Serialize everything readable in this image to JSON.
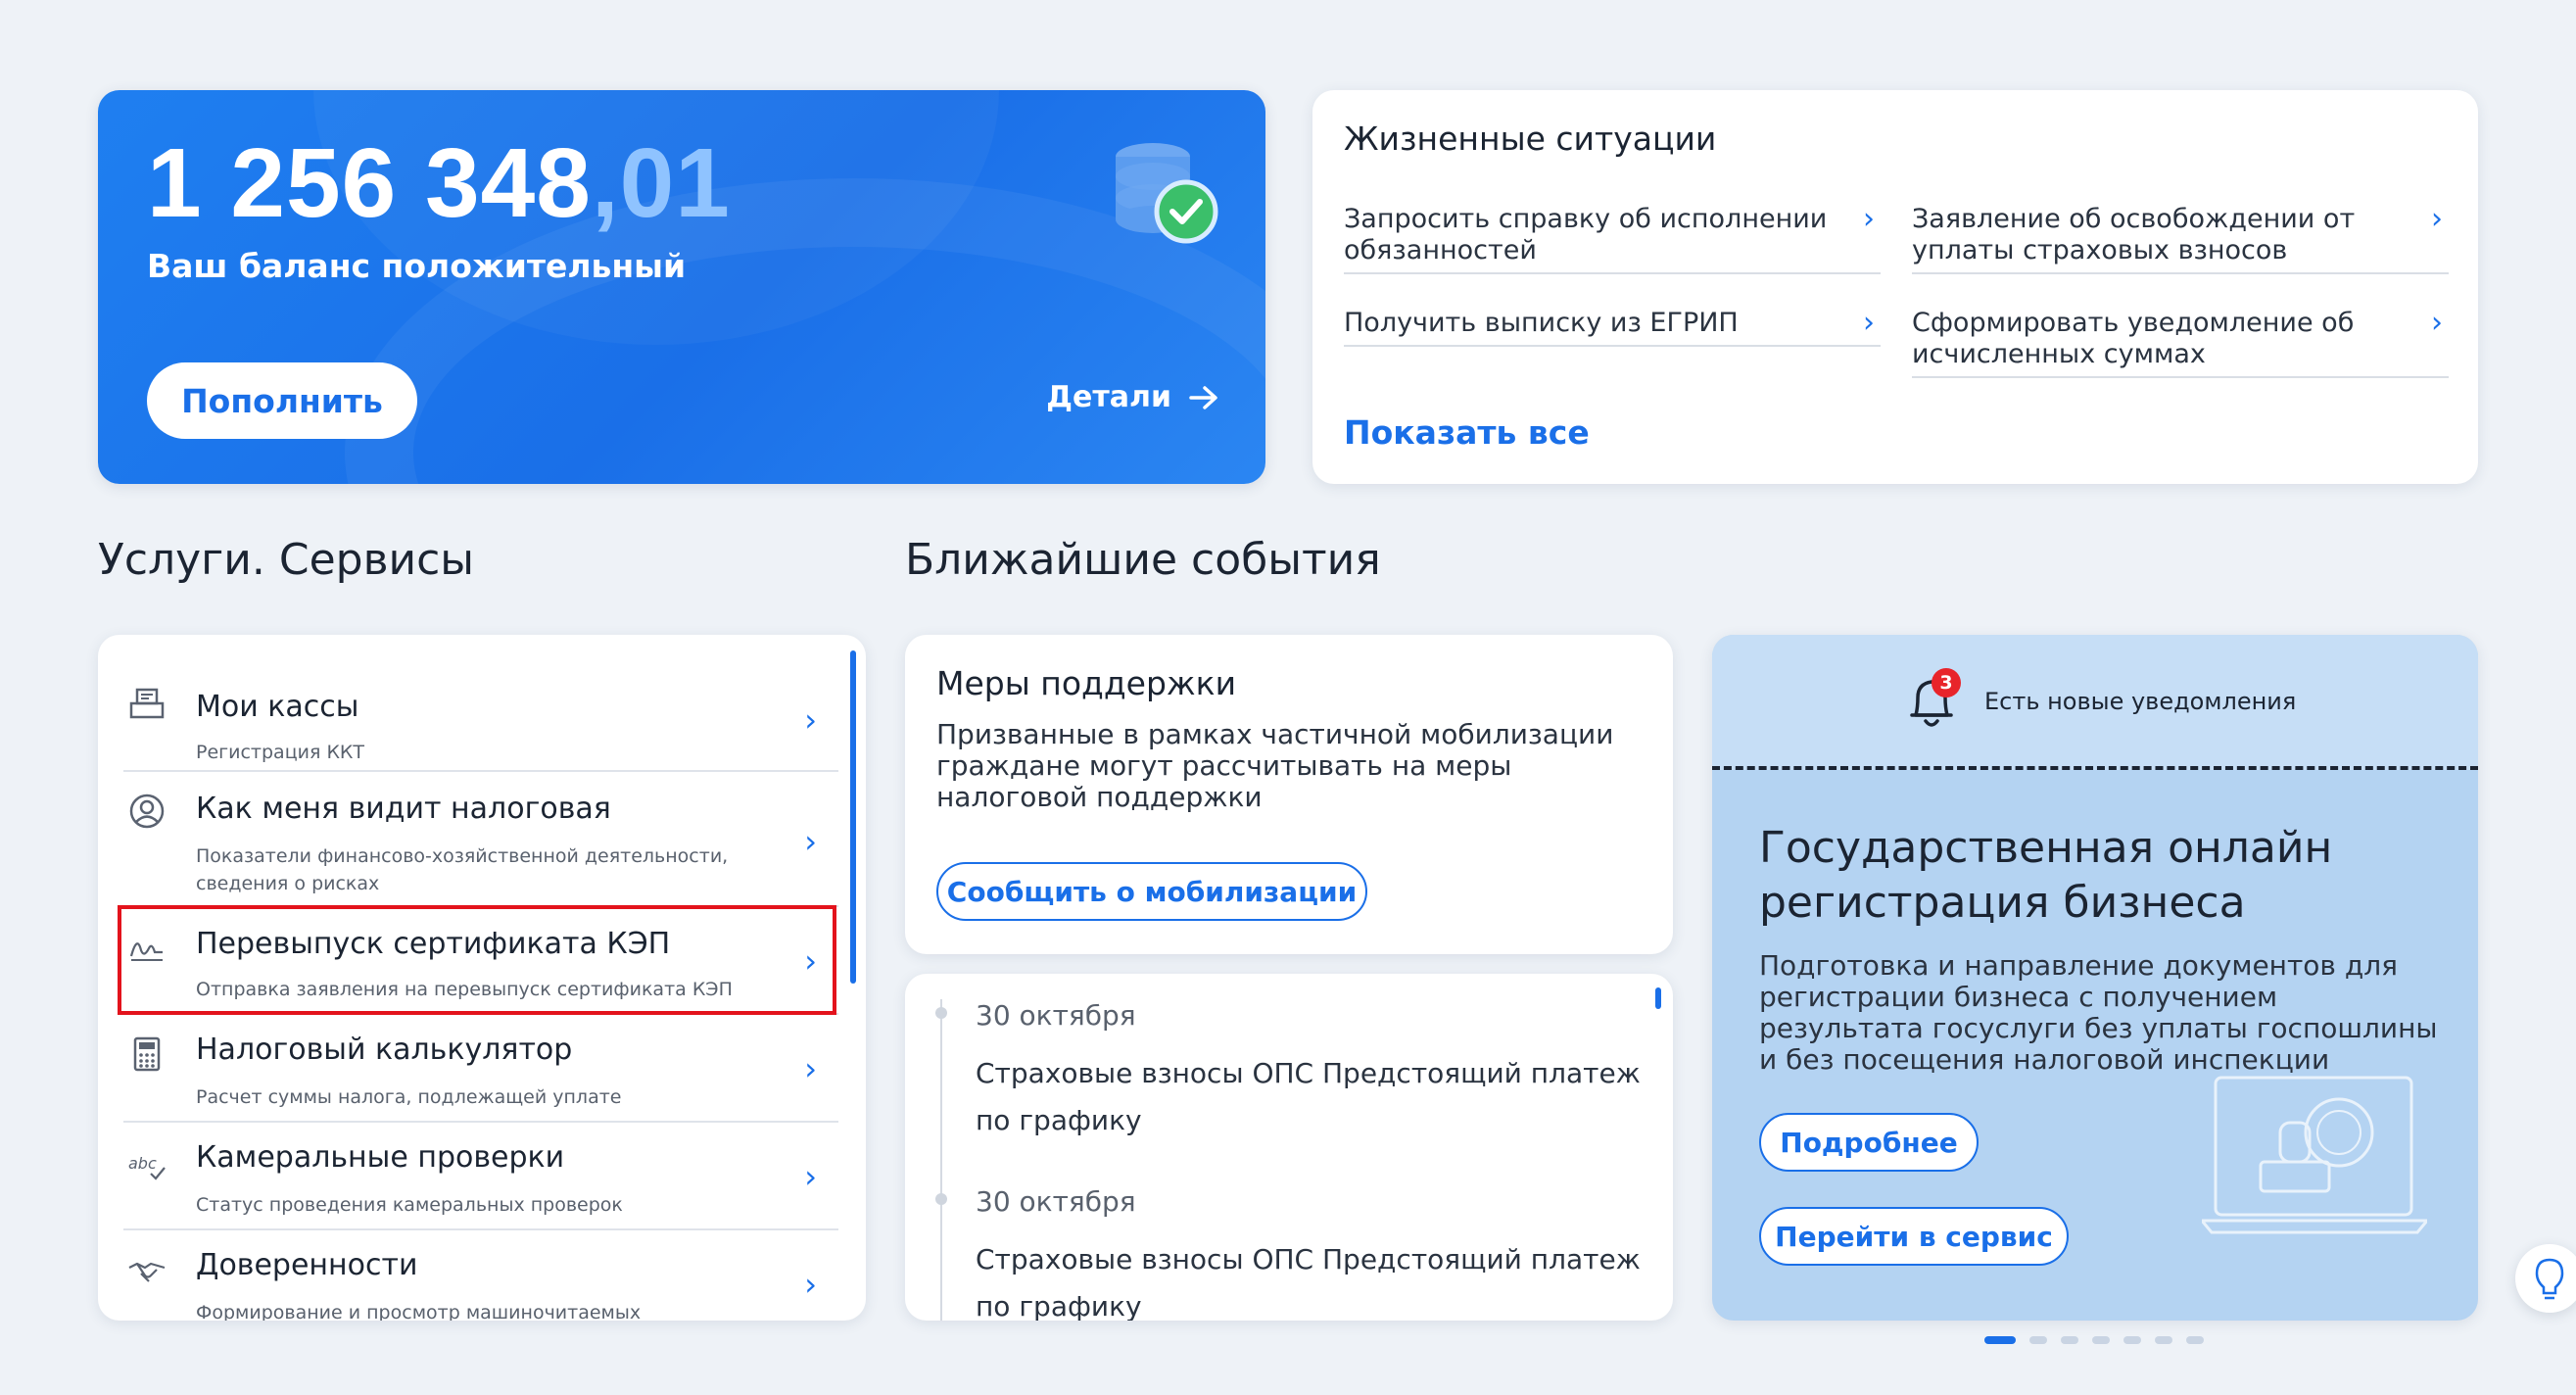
{
  "balance": {
    "amount_main": "1 256 348",
    "amount_kop": ",01",
    "status": "Ваш баланс положительный",
    "topup_label": "Пополнить",
    "details_label": "Детали"
  },
  "life_situations": {
    "title": "Жизненные ситуации",
    "items": [
      {
        "label": "Запросить справку об исполнении обязанностей"
      },
      {
        "label": "Заявление об освобождении от уплаты страховых взносов"
      },
      {
        "label": "Получить выписку из ЕГРИП"
      },
      {
        "label": "Сформировать уведомление об исчисленных суммах"
      }
    ],
    "show_all": "Показать все"
  },
  "services": {
    "title": "Услуги. Сервисы",
    "items": [
      {
        "title": "Мои кассы",
        "subtitle": "Регистрация ККТ",
        "icon": "cash-register-icon"
      },
      {
        "title": "Как меня видит налоговая",
        "subtitle": "Показатели финансово-хозяйственной деятельности, сведения о рисках",
        "icon": "user-circle-icon"
      },
      {
        "title": "Перевыпуск сертификата КЭП",
        "subtitle": "Отправка заявления на перевыпуск сертификата КЭП",
        "icon": "signature-icon"
      },
      {
        "title": "Налоговый калькулятор",
        "subtitle": "Расчет суммы налога, подлежащей уплате",
        "icon": "calculator-icon"
      },
      {
        "title": "Камеральные проверки",
        "subtitle": "Статус проведения камеральных проверок",
        "icon": "abc-check-icon"
      },
      {
        "title": "Доверенности",
        "subtitle": "Формирование и просмотр машиночитаемых доверенностей",
        "icon": "handshake-icon"
      }
    ]
  },
  "events": {
    "title": "Ближайшие события",
    "support": {
      "title": "Меры поддержки",
      "text": "Призванные в рамках частичной мобилизации граждане могут рассчитывать на меры налоговой поддержки",
      "button": "Сообщить о мобилизации"
    },
    "items": [
      {
        "date": "30 октября",
        "text": "Страховые взносы ОПС Предстоящий платеж по графику"
      },
      {
        "date": "30 октября",
        "text": "Страховые взносы ОПС Предстоящий платеж по графику"
      }
    ]
  },
  "promo": {
    "notification_count": "3",
    "notification_text": "Есть новые уведомления",
    "title": "Государственная онлайн регистрация бизнеса",
    "text": "Подготовка и направление документов для регистрации бизнеса с получением результата госуслуги без уплаты госпошлины и без посещения налоговой инспекции",
    "more_button": "Подробнее",
    "service_button": "Перейти в сервис"
  },
  "pagination": {
    "count": 7,
    "active": 0
  },
  "colors": {
    "accent": "#1a6fe8",
    "highlight": "#e3131c",
    "badge": "#e8242a"
  }
}
